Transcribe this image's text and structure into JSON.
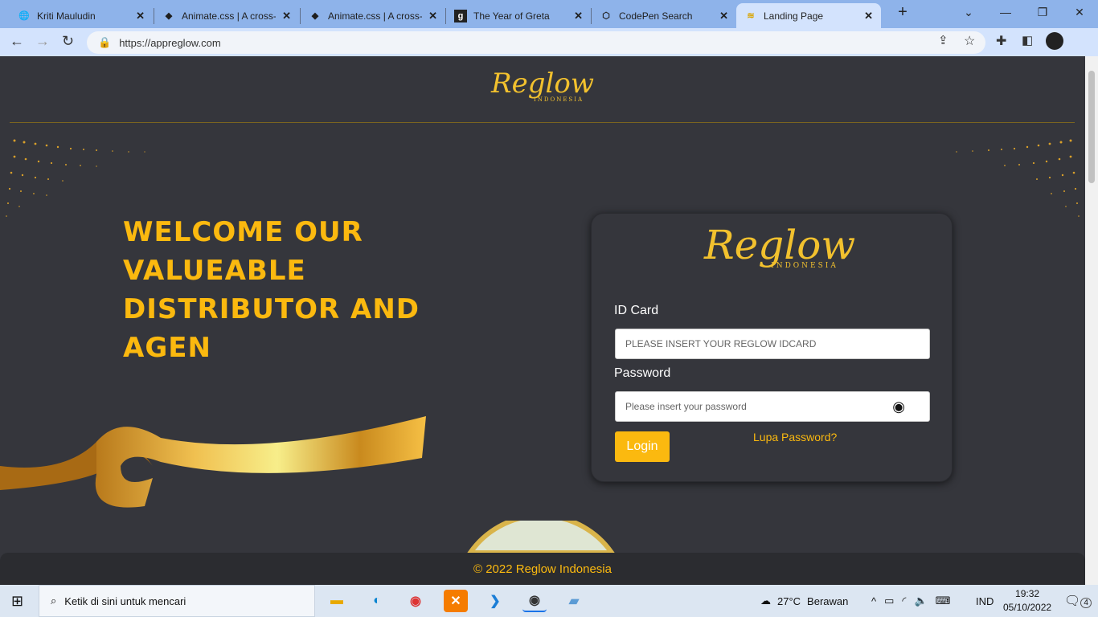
{
  "browser": {
    "tabs": [
      {
        "title": "Kriti Mauludin",
        "icon": "globe-icon"
      },
      {
        "title": "Animate.css | A cross-",
        "icon": "animate-icon"
      },
      {
        "title": "Animate.css | A cross-",
        "icon": "animate-icon"
      },
      {
        "title": "The Year of Greta",
        "icon": "g-icon"
      },
      {
        "title": "CodePen Search",
        "icon": "codepen-icon"
      },
      {
        "title": "Landing Page",
        "icon": "wave-icon",
        "active": true
      }
    ],
    "url": "https://appreglow.com"
  },
  "page": {
    "logo_text": "Reglow",
    "logo_sub": "INDONESIA",
    "welcome": "WELCOME OUR VALUEABLE DISTRIBUTOR AND AGEN",
    "form": {
      "id_label": "ID Card",
      "id_placeholder": "PLEASE INSERT YOUR REGLOW IDCARD",
      "pw_label": "Password",
      "pw_placeholder": "Please insert your password",
      "login": "Login",
      "forgot": "Lupa Password?"
    },
    "footer": "© 2022 Reglow Indonesia",
    "accent": "#fbb90f"
  },
  "taskbar": {
    "search_placeholder": "Ketik di sini untuk mencari",
    "weather": "27°C",
    "weather_desc": "Berawan",
    "lang": "IND",
    "time": "19:32",
    "date": "05/10/2022",
    "notifications": "4"
  }
}
